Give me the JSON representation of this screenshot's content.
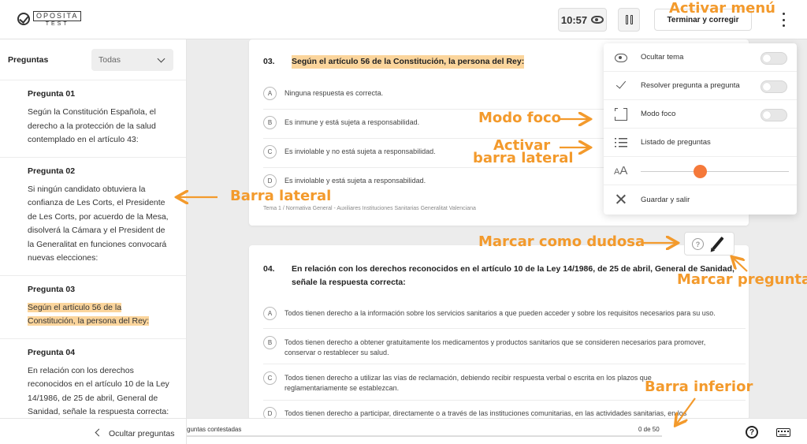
{
  "header": {
    "logo_text_top": "OPOSITA",
    "logo_text_bottom": "TEST",
    "timer": "10:57",
    "finish_label": "Terminar y corregir"
  },
  "sidebar": {
    "title": "Preguntas",
    "filter_value": "Todas",
    "items": [
      {
        "label": "Pregunta 01",
        "text": "Según la Constitución Española, el derecho a la protección de la salud contemplado en el artículo 43:"
      },
      {
        "label": "Pregunta 02",
        "text": "Si ningún candidato obtuviera la confianza de Les Corts, el Presidente de Les Corts, por acuerdo de la Mesa, disolverá la Cámara y el President de la Generalitat en funciones convocará nuevas elecciones:"
      },
      {
        "label": "Pregunta 03",
        "text": "Según el artículo 56 de la Constitución, la persona del Rey:"
      },
      {
        "label": "Pregunta 04",
        "text": "En relación con los derechos reconocidos en el artículo 10 de la Ley 14/1986, de 25 de abril, General de Sanidad, señale la respuesta correcta:"
      }
    ],
    "hide_label": "Ocultar preguntas"
  },
  "question3": {
    "number": "03.",
    "text": "Según el artículo 56 de la Constitución, la persona del Rey:",
    "options": [
      {
        "letter": "A",
        "text": "Ninguna respuesta es correcta."
      },
      {
        "letter": "B",
        "text": "Es inmune y está sujeta a responsabilidad."
      },
      {
        "letter": "C",
        "text": "Es inviolable y no está sujeta a responsabilidad."
      },
      {
        "letter": "D",
        "text": "Es inviolable y está sujeta a responsabilidad."
      }
    ],
    "footer": "Tema 1 / Normativa General - Auxiliares Instituciones Sanitarias Generalitat Valenciana"
  },
  "question4": {
    "number": "04.",
    "text": "En relación con los derechos reconocidos en el artículo 10 de la Ley 14/1986, de 25 de abril, General de Sanidad, señale la respuesta correcta:",
    "options": [
      {
        "letter": "A",
        "text": "Todos tienen derecho a la información sobre los servicios sanitarios a que pueden acceder y sobre los requisitos necesarios para su uso."
      },
      {
        "letter": "B",
        "text": "Todos tienen derecho a obtener gratuitamente los medicamentos y productos sanitarios que se consideren necesarios para promover, conservar o restablecer su salud."
      },
      {
        "letter": "C",
        "text": "Todos tienen derecho a utilizar las vías de reclamación, debiendo recibir respuesta verbal o escrita en los plazos que reglamentariamente se establezcan."
      },
      {
        "letter": "D",
        "text": "Todos tienen derecho a participar, directamente o a través de las instituciones comunitarias, en las actividades sanitarias, en los"
      }
    ]
  },
  "bottombar": {
    "progress_label": "guntas contestadas",
    "count": "0 de 50",
    "progress_fraction": 0
  },
  "menu": {
    "hide_topic": "Ocultar tema",
    "resolve_each": "Resolver pregunta a pregunta",
    "focus_mode": "Modo foco",
    "question_list": "Listado de preguntas",
    "font_size_label_small": "A",
    "font_size_label_large": "A",
    "font_size_fraction": 0.4,
    "save_exit": "Guardar y salir"
  },
  "annotations": {
    "activar_menu": "Activar menú",
    "modo_foco": "Modo foco",
    "activar_barra_1": "Activar",
    "activar_barra_2": "barra lateral",
    "barra_lateral": "Barra lateral",
    "marcar_dudosa": "Marcar como dudosa",
    "marcar_pregunta": "Marcar pregunta",
    "barra_inferior": "Barra inferior"
  },
  "colors": {
    "accent": "#f39a2c",
    "highlight": "#fbd59c",
    "slider_thumb": "#f5793a"
  }
}
